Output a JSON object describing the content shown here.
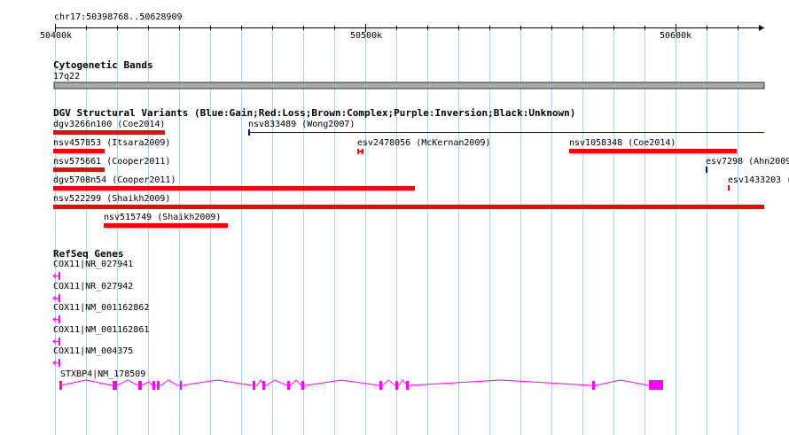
{
  "ruler": {
    "region": "chr17:50398768..50628909",
    "ticks": [
      "50400k",
      "50500k",
      "50600k"
    ]
  },
  "cytoband": {
    "title": "Cytogenetic Bands",
    "band": "17q22",
    "color": "#aaaaaa"
  },
  "dgv": {
    "title": "DGV Structural Variants (Blue:Gain;Red:Loss;Brown:Complex;Purple:Inversion;Black:Unknown)",
    "colors": {
      "loss": "#ff0000",
      "gain": "#0000cc"
    },
    "variants": [
      {
        "label": "dgv3266n100 (Coe2014)",
        "type": "loss"
      },
      {
        "label": "nsv833489 (Wong2007)",
        "type": "gain"
      },
      {
        "label": "nsv457853 (Itsara2009)",
        "type": "loss"
      },
      {
        "label": "esv2478056 (McKernan2009)",
        "type": "loss"
      },
      {
        "label": "nsv1058348 (Coe2014)",
        "type": "loss"
      },
      {
        "label": "nsv575661 (Cooper2011)",
        "type": "loss"
      },
      {
        "label": "esv7298 (Ahn2009",
        "type": "gain"
      },
      {
        "label": "dgv5708n54 (Cooper2011)",
        "type": "loss"
      },
      {
        "label": "esv1433203 (",
        "type": "loss"
      },
      {
        "label": "nsv522299 (Shaikh2009)",
        "type": "loss"
      },
      {
        "label": "nsv515749 (Shaikh2009)",
        "type": "loss"
      }
    ]
  },
  "refseq": {
    "title": "RefSeq Genes",
    "color": "#ff00ff",
    "genes": [
      {
        "label": "COX11|NR_027941"
      },
      {
        "label": "COX11|NR_027942"
      },
      {
        "label": "COX11|NM_001162862"
      },
      {
        "label": "COX11|NM_001162861"
      },
      {
        "label": "COX11|NM_004375"
      },
      {
        "label": "STXBP4|NM_178509"
      }
    ]
  }
}
